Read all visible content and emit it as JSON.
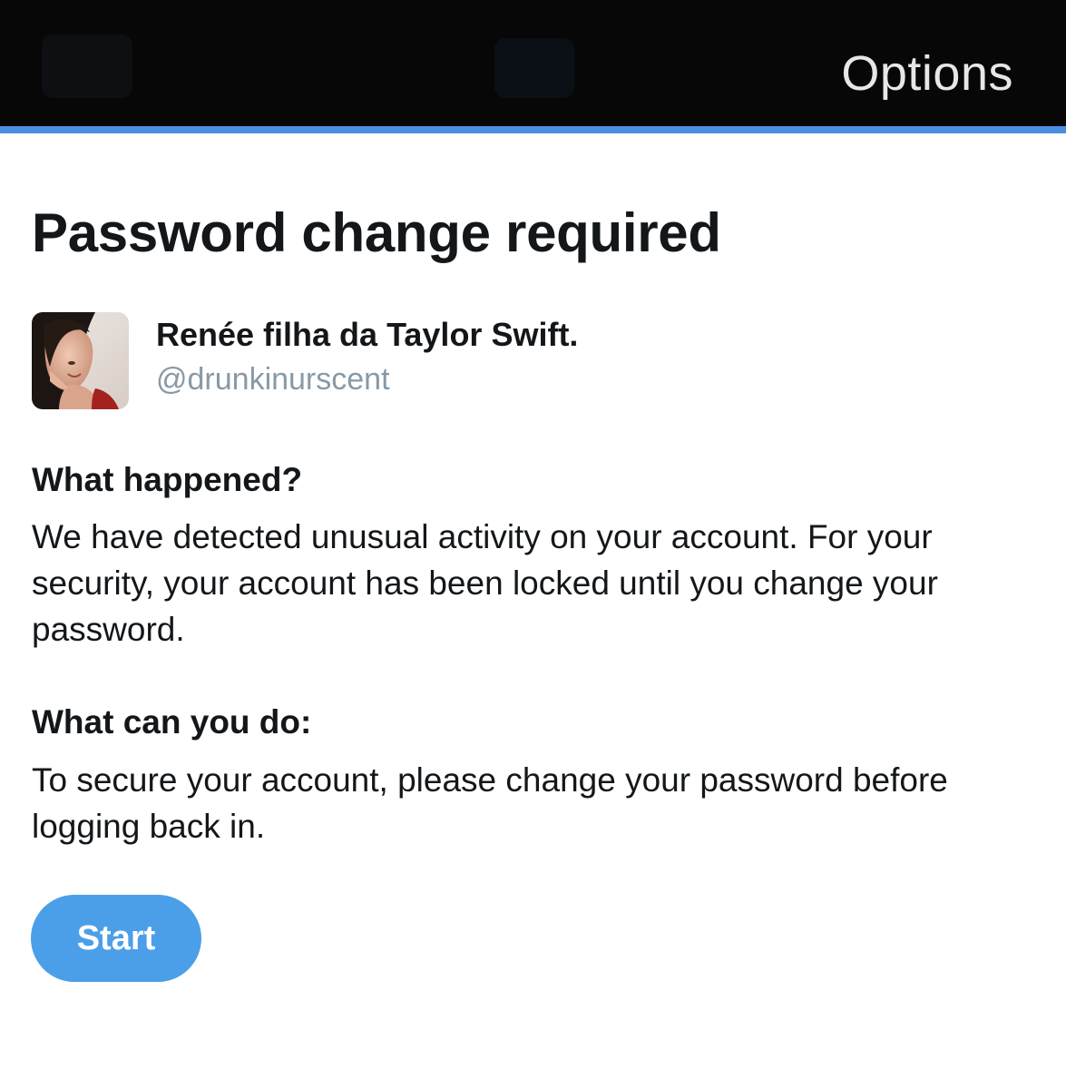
{
  "header": {
    "options_label": "Options"
  },
  "page": {
    "title": "Password change required"
  },
  "account": {
    "display_name": "Renée filha da Taylor Swift.",
    "handle": "@drunkinurscent",
    "avatar_icon": "profile-photo-icon"
  },
  "sections": [
    {
      "heading": "What happened?",
      "body": "We have detected unusual activity on your account. For your security, your account has been locked until you change your password."
    },
    {
      "heading": "What can you do:",
      "body": "To secure your account, please change your password before logging back in."
    }
  ],
  "actions": {
    "start_label": "Start"
  },
  "colors": {
    "header_background": "#070708",
    "accent_line": "#4a8fe0",
    "button_background": "#4b9fe8",
    "handle_text": "#8899a6",
    "primary_text": "#14171a"
  }
}
